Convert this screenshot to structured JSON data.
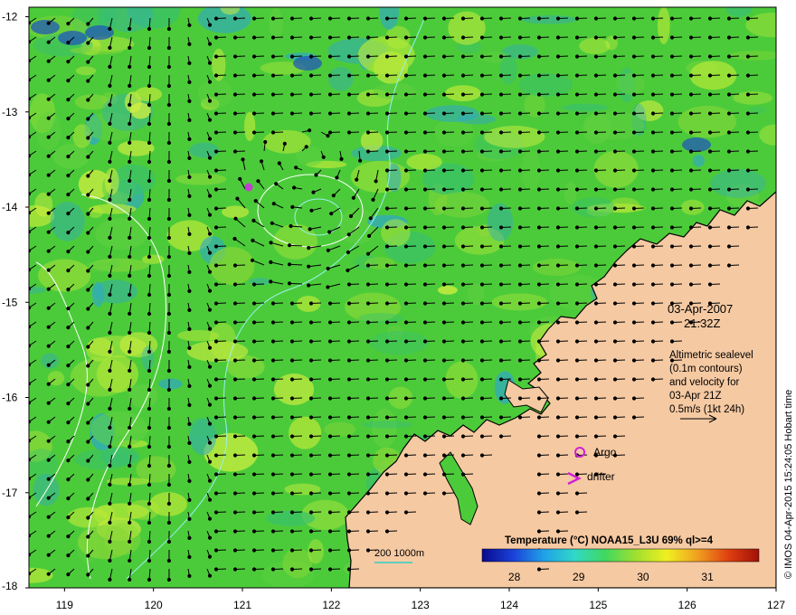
{
  "map": {
    "lon_range": [
      118.6,
      127.0
    ],
    "lat_range": [
      -18.0,
      -11.9
    ],
    "lon_ticks": [
      "119",
      "120",
      "121",
      "122",
      "123",
      "124",
      "125",
      "126",
      "127"
    ],
    "lat_ticks": [
      "-12",
      "-13",
      "-14",
      "-15",
      "-16",
      "-17",
      "-18"
    ],
    "colors": {
      "land": "#f5c9a2",
      "ocean_base": "#4ccb3a",
      "warm_patch": "#b8e838",
      "cool_patch": "#2fa8c8",
      "contour_cool": "#9af0f0",
      "contour_white": "#ffffff",
      "arrow": "#000000",
      "argo": "#d020d8",
      "drifter": "#d020d8"
    }
  },
  "datetime": {
    "date": "03-Apr-2007",
    "time": "21:32Z"
  },
  "info": {
    "line1": "Altimetric sealevel",
    "line2": "(0.1m contours)",
    "line3": "and velocity for",
    "line4": "03-Apr 21Z",
    "line5": "0.5m/s (1kt 24h)"
  },
  "legend": {
    "argo_label": "Argo",
    "drifter_label": "drifter",
    "depth_label": "200  1000m",
    "colorbar_title": "Temperature (°C) NOAA15_L3U 69% ql>=4",
    "colorbar_ticks": [
      "28",
      "29",
      "30",
      "31"
    ],
    "colorbar_range": [
      27.5,
      31.8
    ],
    "colorbar_stops": [
      "#0a0a8c",
      "#1a40d8",
      "#20a0e8",
      "#30d8c8",
      "#40d860",
      "#a0e030",
      "#f0f020",
      "#f0a020",
      "#e04010",
      "#a01008"
    ]
  },
  "credit": "© IMOS 04-Apr-2015 15:24:05 Hobart time"
}
